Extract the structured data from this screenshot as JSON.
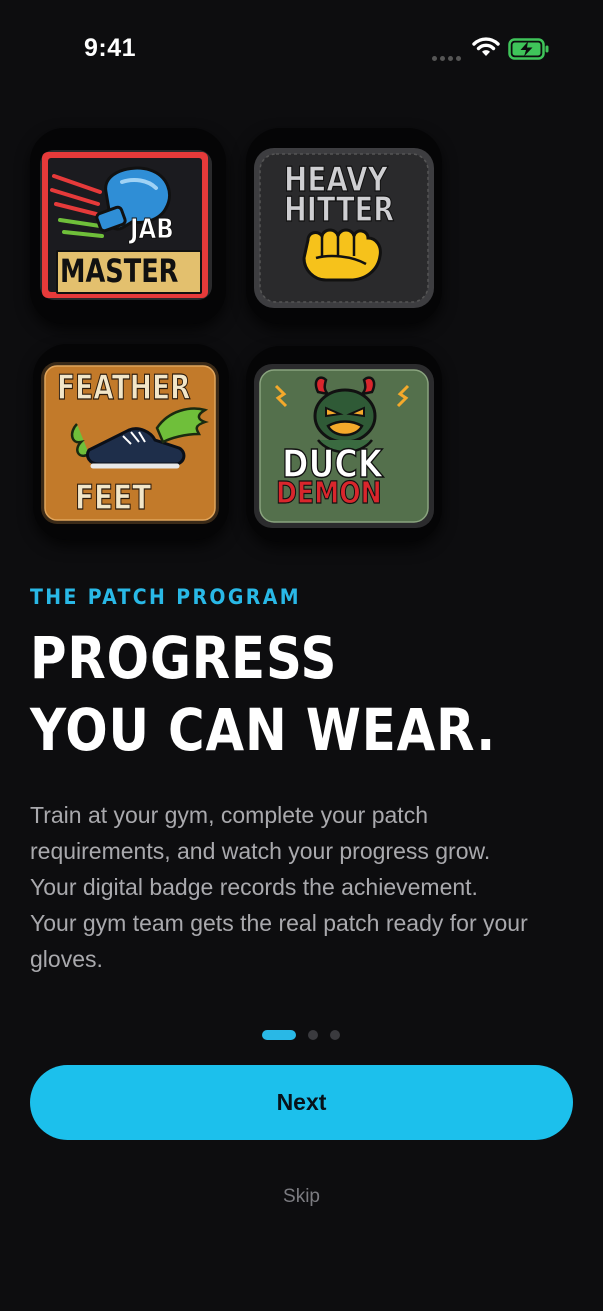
{
  "status_bar": {
    "time": "9:41",
    "icons": [
      "signal-dots-icon",
      "wifi-icon",
      "battery-charging-icon"
    ],
    "battery_color": "#3fc45a"
  },
  "patches": [
    {
      "name": "jab-master",
      "line1": "JAB",
      "line2": "MASTER",
      "icon": "boxing-glove-icon",
      "frame_color": "#e63a3a",
      "band_color": "#e3c06e"
    },
    {
      "name": "heavy-hitter",
      "line1": "HEAVY",
      "line2": "HITTER",
      "icon": "fist-icon",
      "base_color": "#2a2a2c",
      "fist_color": "#f6c21b"
    },
    {
      "name": "feather-feet",
      "line1": "FEATHER",
      "line2": "FEET",
      "icon": "winged-shoe-icon",
      "base_color": "#c27a2a"
    },
    {
      "name": "duck-demon",
      "line1": "DUCK",
      "line2": "DEMON",
      "icon": "devil-duck-icon",
      "base_color": "#54704c",
      "accent_color": "#d9262c"
    }
  ],
  "onboarding": {
    "eyebrow": "THE PATCH PROGRAM",
    "headline_line1": "PROGRESS",
    "headline_line2": "YOU CAN WEAR.",
    "body": "Train at your gym, complete your patch requirements, and watch your progress grow. Your digital badge records the achievement. Your gym team gets the real patch ready for your gloves."
  },
  "pager": {
    "total": 3,
    "current": 1
  },
  "actions": {
    "next_label": "Next",
    "skip_label": "Skip"
  },
  "colors": {
    "accent": "#1cc0ec",
    "background": "#0d0d0f",
    "body_text": "#a9a9ad"
  }
}
